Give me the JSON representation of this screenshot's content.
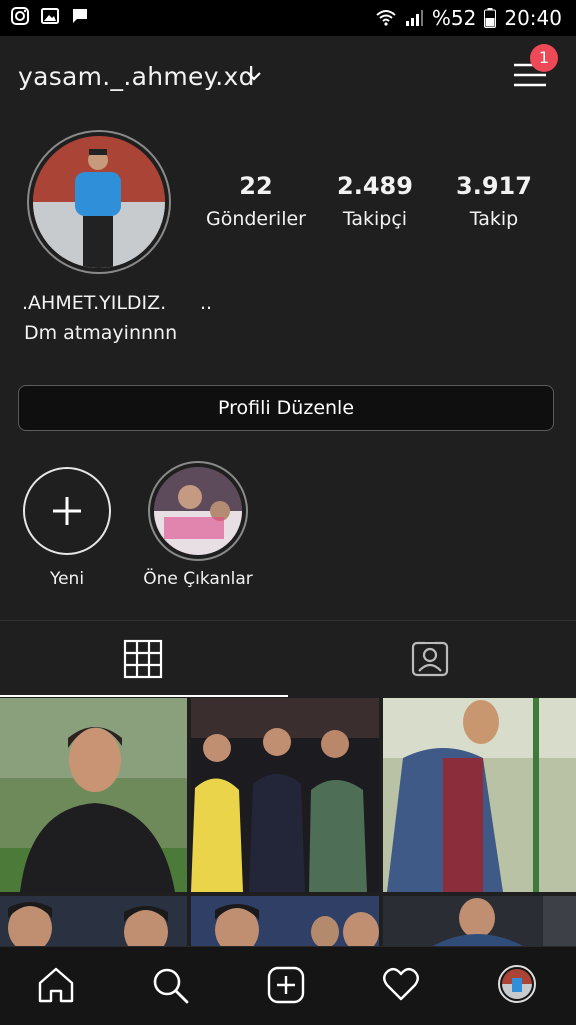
{
  "status_bar": {
    "battery_text": "%52",
    "time": "20:40",
    "left_icons": [
      "instagram-icon",
      "image-icon",
      "message-icon"
    ],
    "right_icons": [
      "wifi-icon",
      "signal-icon",
      "battery-icon"
    ]
  },
  "header": {
    "username": "yasam._.ahmey.xd",
    "menu_badge": "1"
  },
  "profile": {
    "stats": [
      {
        "value": "22",
        "label": "Gönderiler"
      },
      {
        "value": "2.489",
        "label": "Takipçi"
      },
      {
        "value": "3.917",
        "label": "Takip"
      }
    ],
    "bio_name": ".AHMET.YILDIZ.",
    "bio_dots": "..",
    "bio_text": "Dm atmayinnnn",
    "edit_button": "Profili Düzenle"
  },
  "highlights": [
    {
      "label": "Yeni"
    },
    {
      "label": "Öne Çıkanlar"
    }
  ],
  "tabs": [
    "grid-icon",
    "tagged-icon"
  ],
  "bottom_nav": [
    "home-icon",
    "search-icon",
    "add-post-icon",
    "heart-icon",
    "profile-avatar"
  ],
  "colors": {
    "background": "#1f1f1f",
    "badge": "#ed4956"
  }
}
